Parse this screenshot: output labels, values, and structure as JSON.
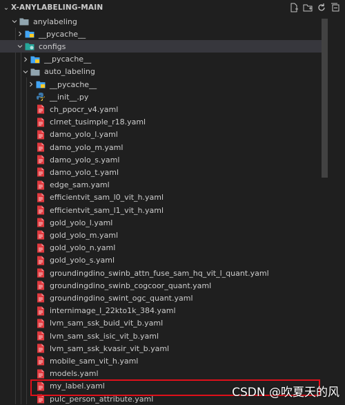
{
  "header": {
    "title": "X-ANYLABELING-MAIN",
    "actions": [
      "new-file-icon",
      "new-folder-icon",
      "refresh-icon",
      "collapse-all-icon"
    ]
  },
  "tree": [
    {
      "label": "anylabeling",
      "type": "folder",
      "expanded": true,
      "depth": 0
    },
    {
      "label": "__pycache__",
      "type": "folder-blue",
      "expanded": false,
      "depth": 1
    },
    {
      "label": "configs",
      "type": "folder-config",
      "expanded": true,
      "depth": 1,
      "selected": true
    },
    {
      "label": "__pycache__",
      "type": "folder-blue",
      "expanded": false,
      "depth": 2
    },
    {
      "label": "auto_labeling",
      "type": "folder",
      "expanded": true,
      "depth": 2
    },
    {
      "label": "__pycache__",
      "type": "folder-blue",
      "expanded": false,
      "depth": 3
    },
    {
      "label": "__init__.py",
      "type": "python",
      "depth": 3
    },
    {
      "label": "ch_ppocr_v4.yaml",
      "type": "yaml",
      "depth": 3
    },
    {
      "label": "clrnet_tusimple_r18.yaml",
      "type": "yaml",
      "depth": 3
    },
    {
      "label": "damo_yolo_l.yaml",
      "type": "yaml",
      "depth": 3
    },
    {
      "label": "damo_yolo_m.yaml",
      "type": "yaml",
      "depth": 3
    },
    {
      "label": "damo_yolo_s.yaml",
      "type": "yaml",
      "depth": 3
    },
    {
      "label": "damo_yolo_t.yaml",
      "type": "yaml",
      "depth": 3
    },
    {
      "label": "edge_sam.yaml",
      "type": "yaml",
      "depth": 3
    },
    {
      "label": "efficientvit_sam_l0_vit_h.yaml",
      "type": "yaml",
      "depth": 3
    },
    {
      "label": "efficientvit_sam_l1_vit_h.yaml",
      "type": "yaml",
      "depth": 3
    },
    {
      "label": "gold_yolo_l.yaml",
      "type": "yaml",
      "depth": 3
    },
    {
      "label": "gold_yolo_m.yaml",
      "type": "yaml",
      "depth": 3
    },
    {
      "label": "gold_yolo_n.yaml",
      "type": "yaml",
      "depth": 3
    },
    {
      "label": "gold_yolo_s.yaml",
      "type": "yaml",
      "depth": 3
    },
    {
      "label": "groundingdino_swinb_attn_fuse_sam_hq_vit_l_quant.yaml",
      "type": "yaml",
      "depth": 3
    },
    {
      "label": "groundingdino_swinb_cogcoor_quant.yaml",
      "type": "yaml",
      "depth": 3
    },
    {
      "label": "groundingdino_swint_ogc_quant.yaml",
      "type": "yaml",
      "depth": 3
    },
    {
      "label": "internimage_l_22kto1k_384.yaml",
      "type": "yaml",
      "depth": 3
    },
    {
      "label": "lvm_sam_ssk_buid_vit_b.yaml",
      "type": "yaml",
      "depth": 3
    },
    {
      "label": "lvm_sam_ssk_isic_vit_b.yaml",
      "type": "yaml",
      "depth": 3
    },
    {
      "label": "lvm_sam_ssk_kvasir_vit_b.yaml",
      "type": "yaml",
      "depth": 3
    },
    {
      "label": "mobile_sam_vit_h.yaml",
      "type": "yaml",
      "depth": 3
    },
    {
      "label": "models.yaml",
      "type": "yaml",
      "depth": 3
    },
    {
      "label": "my_label.yaml",
      "type": "yaml",
      "depth": 3,
      "highlighted": true
    },
    {
      "label": "pulc_person_attribute.yaml",
      "type": "yaml",
      "depth": 3
    }
  ],
  "watermark": "CSDN @吹夏天的风",
  "colors": {
    "background": "#1f1f1f",
    "selected_row": "#37373d",
    "yaml_icon": "#e0393e",
    "folder_blue": "#42a5f5",
    "folder_gray": "#90a4ae",
    "highlight_border": "#e0101a"
  }
}
